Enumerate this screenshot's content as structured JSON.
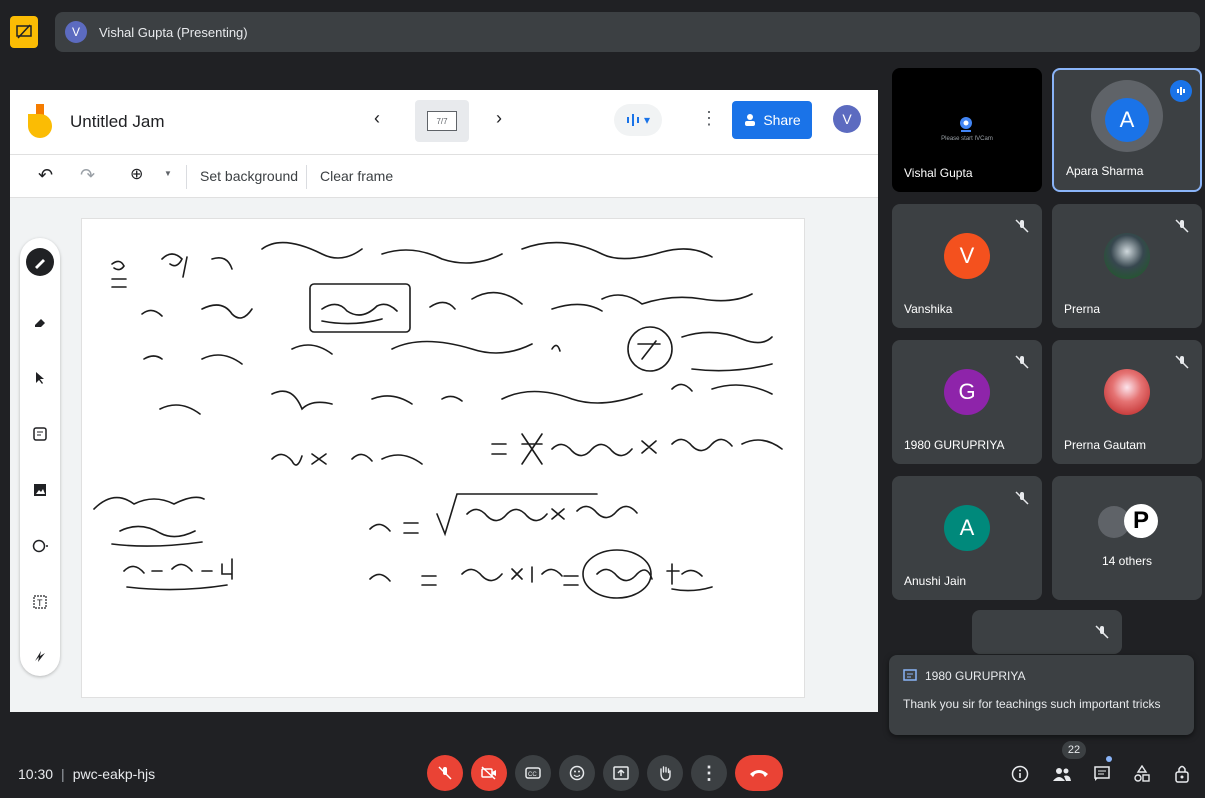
{
  "presenting": {
    "avatar_letter": "V",
    "name": "Vishal Gupta (Presenting)"
  },
  "jam": {
    "title": "Untitled Jam",
    "frame_indicator": "7/7",
    "share_label": "Share",
    "user_avatar": "V",
    "toolbar": {
      "set_background": "Set background",
      "clear_frame": "Clear frame"
    }
  },
  "tiles": [
    {
      "name": "Vishal Gupta",
      "camera_text": "Please start IVCam"
    },
    {
      "name": "Apara Sharma",
      "letter": "A"
    },
    {
      "name": "Vanshika",
      "letter": "V"
    },
    {
      "name": "Prerna"
    },
    {
      "name": "1980 GURUPRIYA",
      "letter": "G"
    },
    {
      "name": "Prerna Gautam"
    },
    {
      "name": "Anushi Jain",
      "letter": "A"
    },
    {
      "name": "14 others",
      "letter": "P"
    }
  ],
  "chat_toast": {
    "sender": "1980 GURUPRIYA",
    "message": "Thank you sir for teachings such important tricks"
  },
  "meeting": {
    "time": "10:30",
    "code": "pwc-eakp-hjs",
    "people_count": "22"
  },
  "colors": {
    "background": "#202124",
    "tile": "#3c4043",
    "red": "#ea4335",
    "accent": "#1a73e8"
  }
}
